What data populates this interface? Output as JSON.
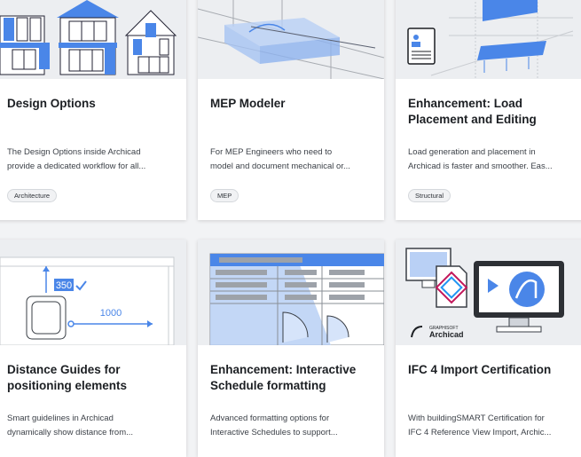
{
  "cards": [
    {
      "title_lines": [
        "Design Options"
      ],
      "desc_lines": [
        "The Design Options inside Archicad",
        "provide a dedicated workflow for all..."
      ],
      "tag": "Architecture"
    },
    {
      "title_lines": [
        "MEP Modeler"
      ],
      "desc_lines": [
        "For MEP Engineers who need to",
        "model and document mechanical or..."
      ],
      "tag": "MEP"
    },
    {
      "title_lines": [
        "Enhancement: Load",
        "Placement and Editing"
      ],
      "desc_lines": [
        "Load generation and placement in",
        "Archicad is faster and smoother. Eas..."
      ],
      "tag": "Structural"
    },
    {
      "title_lines": [
        "Distance Guides for",
        "positioning elements"
      ],
      "desc_lines": [
        "Smart guidelines in Archicad",
        "dynamically show distance from..."
      ]
    },
    {
      "title_lines": [
        "Enhancement: Interactive",
        "Schedule formatting"
      ],
      "desc_lines": [
        "Advanced formatting options for",
        "Interactive Schedules to support..."
      ]
    },
    {
      "title_lines": [
        "IFC 4 Import Certification"
      ],
      "desc_lines": [
        "With buildingSMART Certification for",
        "IFC 4 Reference View Import, Archic..."
      ]
    }
  ],
  "thumbs": {
    "distance_value": "350",
    "distance_value_2": "1000",
    "graphisoft_label": "GRAPHISOFT",
    "archicad_label": "Archicad"
  },
  "colors": {
    "accent": "#4a86e8",
    "accent_light": "#b9d0f5"
  }
}
